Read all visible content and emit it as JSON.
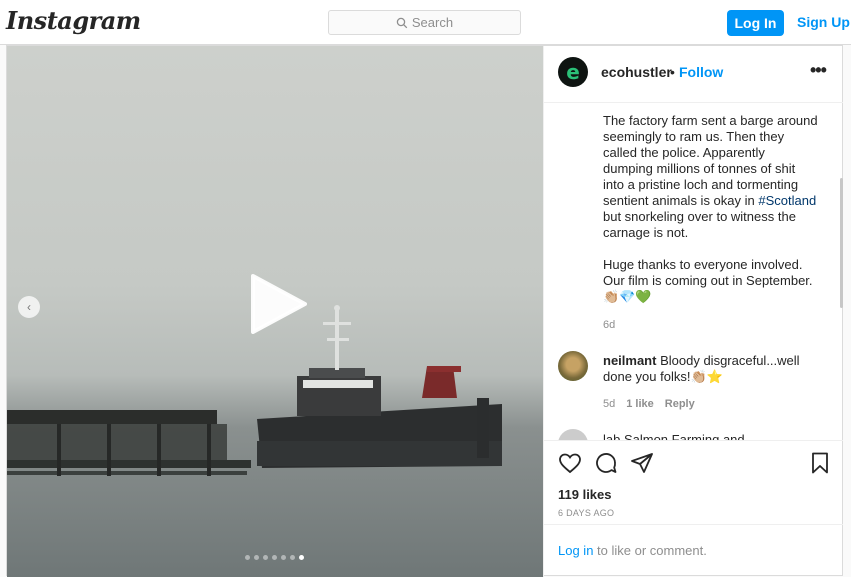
{
  "header": {
    "logo": "Instagram",
    "search_placeholder": "Search",
    "login_label": "Log In",
    "signup_label": "Sign Up"
  },
  "post": {
    "username": "ecohustler",
    "separator": "•",
    "follow_label": "Follow",
    "more_label": "•••",
    "avatar_letter": "e",
    "caption_p1_before": "The factory farm sent a barge around seemingly to ram us. Then they called the police. Apparently dumping millions of tonnes of shit into a pristine loch and tormenting sentient animals is okay in ",
    "caption_hashtag": "#Scotland",
    "caption_p1_after": " but snorkeling over to witness the carnage is not.",
    "caption_p2": "Huge thanks to everyone involved. Our film is coming out in September. 👏🏼💎💚",
    "caption_time": "6d",
    "comments": [
      {
        "user": "neilmant",
        "text": "Bloody disgraceful...well done you folks!👏🏼⭐",
        "time": "5d",
        "likes": "1 like",
        "reply": "Reply"
      }
    ],
    "partial_comment": "lab   Salmon   Farming   and   ...",
    "likes": "119 likes",
    "posted": "6 DAYS AGO",
    "footer_login": "Log in",
    "footer_rest": " to like or comment.",
    "carousel_count": 7,
    "carousel_active": 7,
    "colors": {
      "accent": "#0095f6",
      "hashtag": "#00376b",
      "muted": "#8e8e8e",
      "text": "#262626",
      "border": "#dbdbdb"
    }
  }
}
